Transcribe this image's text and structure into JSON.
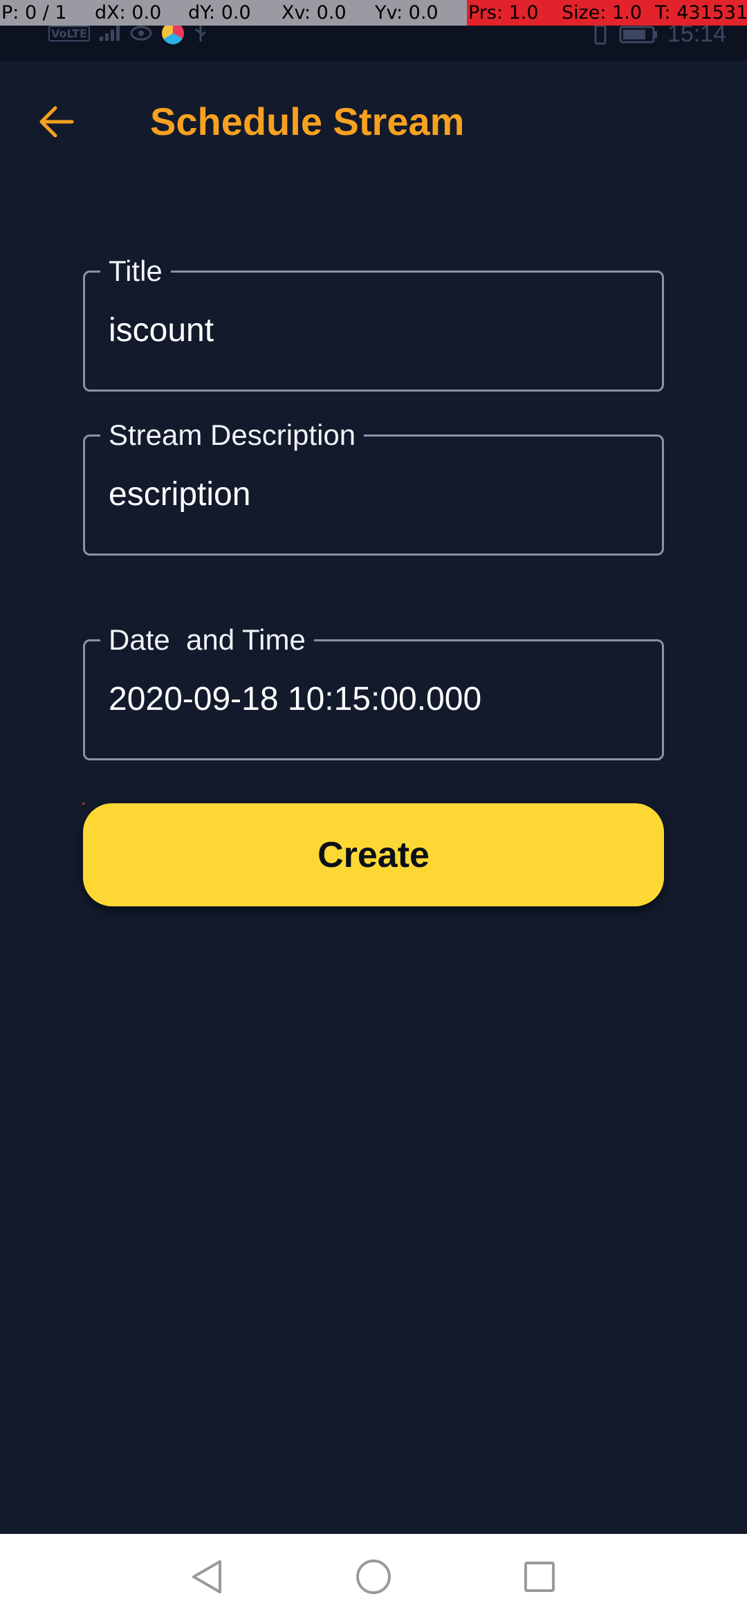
{
  "debug_overlay": {
    "cells": [
      "P: 0 / 1",
      "dX: 0.0",
      "dY: 0.0",
      "Xv: 0.0",
      "Yv: 0.0",
      "Prs: 1.0",
      "Size: 1.0",
      "T: 431531"
    ]
  },
  "status_bar": {
    "volte_label": "VoLTE",
    "time": "15:14",
    "icons": [
      "volte-icon",
      "signal-icon",
      "eye-icon",
      "app-icon",
      "usb-icon",
      "vibrate-icon",
      "battery-icon"
    ]
  },
  "header": {
    "title": "Schedule Stream",
    "back_icon": "arrow-left-icon"
  },
  "form": {
    "title_field": {
      "label": "Title",
      "value": "iscount"
    },
    "description_field": {
      "label": "Stream Description",
      "value": "escription"
    },
    "datetime_field": {
      "label": "Date  and Time",
      "value": "2020-09-18 10:15:00.000"
    },
    "create_button": "Create"
  },
  "nav_bar": {
    "icons": [
      "back-triangle-icon",
      "home-circle-icon",
      "recents-square-icon"
    ]
  },
  "colors": {
    "background": "#121a2c",
    "accent": "#f6a120",
    "button": "#fdd835",
    "field_border": "#8b93a3"
  }
}
